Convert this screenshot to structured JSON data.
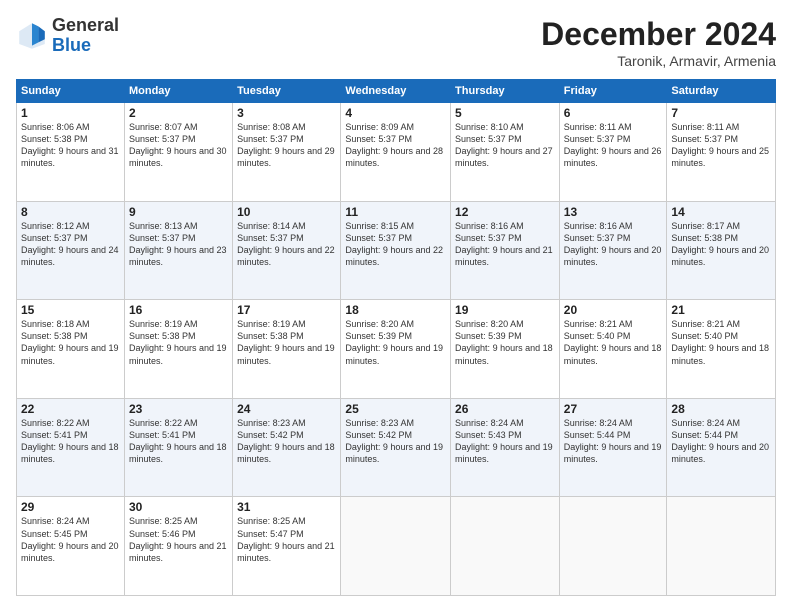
{
  "logo": {
    "general": "General",
    "blue": "Blue"
  },
  "title": "December 2024",
  "subtitle": "Taronik, Armavir, Armenia",
  "headers": [
    "Sunday",
    "Monday",
    "Tuesday",
    "Wednesday",
    "Thursday",
    "Friday",
    "Saturday"
  ],
  "weeks": [
    [
      {
        "day": "1",
        "sunrise": "8:06 AM",
        "sunset": "5:38 PM",
        "daylight": "9 hours and 31 minutes."
      },
      {
        "day": "2",
        "sunrise": "8:07 AM",
        "sunset": "5:37 PM",
        "daylight": "9 hours and 30 minutes."
      },
      {
        "day": "3",
        "sunrise": "8:08 AM",
        "sunset": "5:37 PM",
        "daylight": "9 hours and 29 minutes."
      },
      {
        "day": "4",
        "sunrise": "8:09 AM",
        "sunset": "5:37 PM",
        "daylight": "9 hours and 28 minutes."
      },
      {
        "day": "5",
        "sunrise": "8:10 AM",
        "sunset": "5:37 PM",
        "daylight": "9 hours and 27 minutes."
      },
      {
        "day": "6",
        "sunrise": "8:11 AM",
        "sunset": "5:37 PM",
        "daylight": "9 hours and 26 minutes."
      },
      {
        "day": "7",
        "sunrise": "8:11 AM",
        "sunset": "5:37 PM",
        "daylight": "9 hours and 25 minutes."
      }
    ],
    [
      {
        "day": "8",
        "sunrise": "8:12 AM",
        "sunset": "5:37 PM",
        "daylight": "9 hours and 24 minutes."
      },
      {
        "day": "9",
        "sunrise": "8:13 AM",
        "sunset": "5:37 PM",
        "daylight": "9 hours and 23 minutes."
      },
      {
        "day": "10",
        "sunrise": "8:14 AM",
        "sunset": "5:37 PM",
        "daylight": "9 hours and 22 minutes."
      },
      {
        "day": "11",
        "sunrise": "8:15 AM",
        "sunset": "5:37 PM",
        "daylight": "9 hours and 22 minutes."
      },
      {
        "day": "12",
        "sunrise": "8:16 AM",
        "sunset": "5:37 PM",
        "daylight": "9 hours and 21 minutes."
      },
      {
        "day": "13",
        "sunrise": "8:16 AM",
        "sunset": "5:37 PM",
        "daylight": "9 hours and 20 minutes."
      },
      {
        "day": "14",
        "sunrise": "8:17 AM",
        "sunset": "5:38 PM",
        "daylight": "9 hours and 20 minutes."
      }
    ],
    [
      {
        "day": "15",
        "sunrise": "8:18 AM",
        "sunset": "5:38 PM",
        "daylight": "9 hours and 19 minutes."
      },
      {
        "day": "16",
        "sunrise": "8:19 AM",
        "sunset": "5:38 PM",
        "daylight": "9 hours and 19 minutes."
      },
      {
        "day": "17",
        "sunrise": "8:19 AM",
        "sunset": "5:38 PM",
        "daylight": "9 hours and 19 minutes."
      },
      {
        "day": "18",
        "sunrise": "8:20 AM",
        "sunset": "5:39 PM",
        "daylight": "9 hours and 19 minutes."
      },
      {
        "day": "19",
        "sunrise": "8:20 AM",
        "sunset": "5:39 PM",
        "daylight": "9 hours and 18 minutes."
      },
      {
        "day": "20",
        "sunrise": "8:21 AM",
        "sunset": "5:40 PM",
        "daylight": "9 hours and 18 minutes."
      },
      {
        "day": "21",
        "sunrise": "8:21 AM",
        "sunset": "5:40 PM",
        "daylight": "9 hours and 18 minutes."
      }
    ],
    [
      {
        "day": "22",
        "sunrise": "8:22 AM",
        "sunset": "5:41 PM",
        "daylight": "9 hours and 18 minutes."
      },
      {
        "day": "23",
        "sunrise": "8:22 AM",
        "sunset": "5:41 PM",
        "daylight": "9 hours and 18 minutes."
      },
      {
        "day": "24",
        "sunrise": "8:23 AM",
        "sunset": "5:42 PM",
        "daylight": "9 hours and 18 minutes."
      },
      {
        "day": "25",
        "sunrise": "8:23 AM",
        "sunset": "5:42 PM",
        "daylight": "9 hours and 19 minutes."
      },
      {
        "day": "26",
        "sunrise": "8:24 AM",
        "sunset": "5:43 PM",
        "daylight": "9 hours and 19 minutes."
      },
      {
        "day": "27",
        "sunrise": "8:24 AM",
        "sunset": "5:44 PM",
        "daylight": "9 hours and 19 minutes."
      },
      {
        "day": "28",
        "sunrise": "8:24 AM",
        "sunset": "5:44 PM",
        "daylight": "9 hours and 20 minutes."
      }
    ],
    [
      {
        "day": "29",
        "sunrise": "8:24 AM",
        "sunset": "5:45 PM",
        "daylight": "9 hours and 20 minutes."
      },
      {
        "day": "30",
        "sunrise": "8:25 AM",
        "sunset": "5:46 PM",
        "daylight": "9 hours and 21 minutes."
      },
      {
        "day": "31",
        "sunrise": "8:25 AM",
        "sunset": "5:47 PM",
        "daylight": "9 hours and 21 minutes."
      },
      null,
      null,
      null,
      null
    ]
  ],
  "sunrise_label": "Sunrise:",
  "sunset_label": "Sunset:",
  "daylight_label": "Daylight:"
}
